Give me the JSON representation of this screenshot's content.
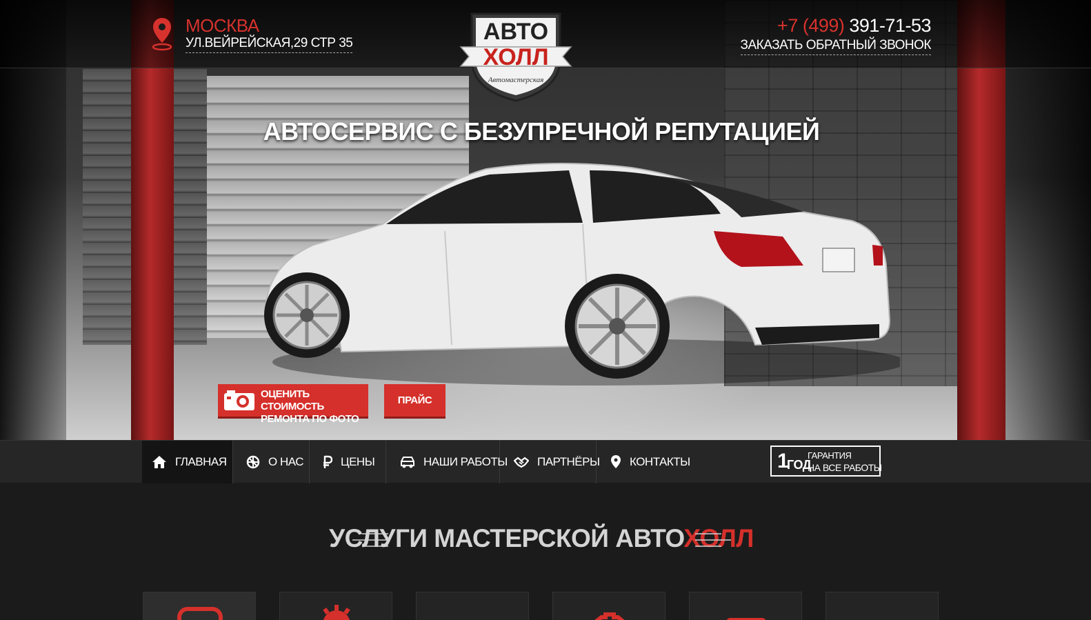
{
  "header": {
    "city": "МОСКВА",
    "address": "УЛ.ВЕЙРЕЙСКАЯ,29 СТР 35",
    "logo": {
      "line1": "АВТО",
      "line2": "ХОЛЛ",
      "tagline": "Автомастерская"
    },
    "phone_code": "+7 (499)",
    "phone_number": "391-71-53",
    "callback_link": "ЗАКАЗАТЬ ОБРАТНЫЙ ЗВОНОК"
  },
  "hero": {
    "title": "АВТОСЕРВИС С БЕЗУПРЕЧНОЙ РЕПУТАЦИЕЙ",
    "estimate_button": "ОЦЕНИТЬ СТОИМОСТЬ\nРЕМОНТА ПО ФОТО",
    "price_button": "ПРАЙС"
  },
  "nav": {
    "items": [
      {
        "label": "ГЛАВНАЯ",
        "icon": "home-icon",
        "active": true
      },
      {
        "label": "О НАС",
        "icon": "wheel-icon",
        "active": false
      },
      {
        "label": "ЦЕНЫ",
        "icon": "ruble-icon",
        "active": false
      },
      {
        "label": "НАШИ РАБОТЫ",
        "icon": "car-icon",
        "active": false
      },
      {
        "label": "ПАРТНЁРЫ",
        "icon": "handshake-icon",
        "active": false
      },
      {
        "label": "КОНТАКТЫ",
        "icon": "pin-icon",
        "active": false
      }
    ]
  },
  "warranty": {
    "number": "1",
    "unit": "ГОД",
    "line1": "ГАРАНТИЯ",
    "line2": "НА ВСЕ РАБОТЫ"
  },
  "services": {
    "title_part1": "УСЛУГИ МАСТЕРСКОЙ ",
    "title_part2": "АВТО",
    "title_part3": "ХОЛЛ"
  },
  "colors": {
    "accent": "#d5302b",
    "background": "#1b1b1b",
    "nav": "#262626"
  }
}
